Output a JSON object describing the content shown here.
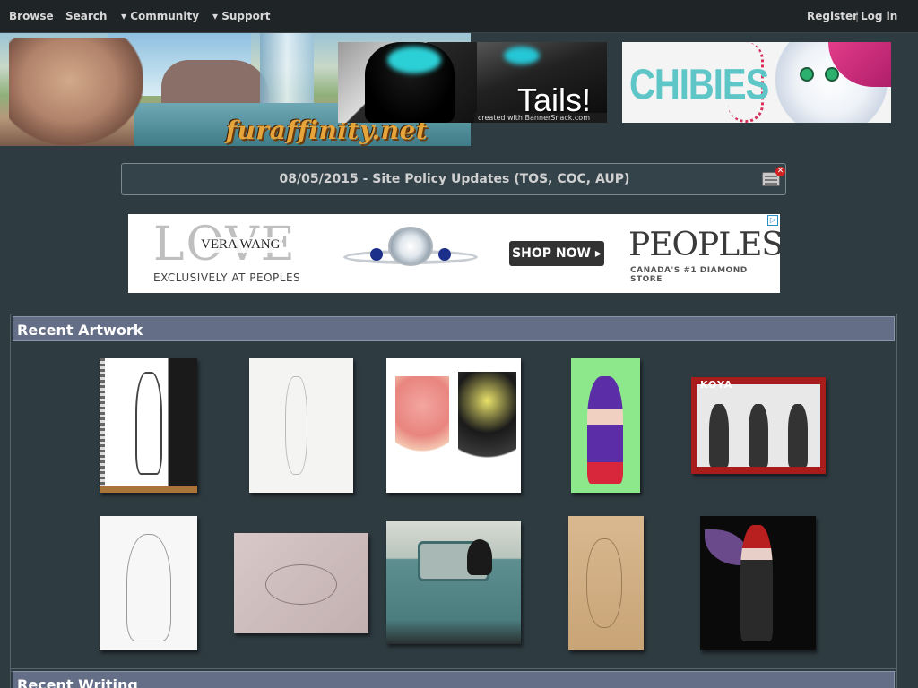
{
  "nav": {
    "browse": "Browse",
    "search": "Search",
    "community": "▾ Community",
    "support": "▾ Support",
    "register": "Register",
    "separator": "|",
    "login": "Log in"
  },
  "header": {
    "logo_text": "furaffinity.net",
    "ad_tails": {
      "label": "Tails!",
      "credit": "created with BannerSnack.com"
    },
    "ad_chibies": {
      "label": "CHIBIES"
    }
  },
  "notice": {
    "text": "08/05/2015 - Site Policy Updates (TOS, COC, AUP)"
  },
  "ad_peoples": {
    "love": "LOVE",
    "vera_wang": "VERA WANG",
    "exclusively": "EXCLUSIVELY AT PEOPLES",
    "shop_now": "SHOP NOW ▸",
    "brand": "PEOPLES",
    "tagline": "CANADA'S #1 DIAMOND STORE",
    "adchoices": "▷"
  },
  "recent_artwork": {
    "title": "Recent Artwork",
    "koya_title": "KOYA"
  },
  "recent_writing": {
    "title": "Recent Writing"
  },
  "colors": {
    "background": "#2e3b41",
    "topnav": "#1f2426",
    "section_header": "#646e87"
  }
}
